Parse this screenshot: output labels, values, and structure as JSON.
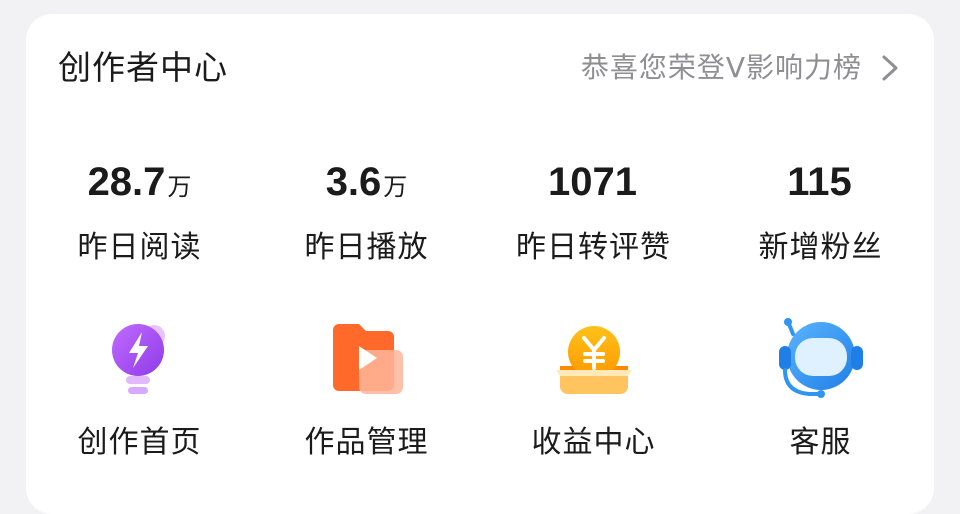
{
  "creator_center": {
    "title": "创作者中心",
    "link_text": "恭喜您荣登V影响力榜"
  },
  "stats": [
    {
      "value": "28.7",
      "unit": "万",
      "label": "昨日阅读"
    },
    {
      "value": "3.6",
      "unit": "万",
      "label": "昨日播放"
    },
    {
      "value": "1071",
      "unit": "",
      "label": "昨日转评赞"
    },
    {
      "value": "115",
      "unit": "",
      "label": "新增粉丝"
    }
  ],
  "tools": [
    {
      "label": "创作首页",
      "icon": "lightbulb-bolt-icon",
      "color": "#a44df0"
    },
    {
      "label": "作品管理",
      "icon": "video-folder-icon",
      "color": "#ff5a2c"
    },
    {
      "label": "收益中心",
      "icon": "yuan-coin-icon",
      "color": "#ffb300"
    },
    {
      "label": "客服",
      "icon": "robot-headset-icon",
      "color": "#2f95f5"
    }
  ],
  "colors": {
    "background": "#f2f2f4",
    "card": "#ffffff",
    "text_primary": "#1b1b1b",
    "text_secondary": "#8e8e93"
  }
}
